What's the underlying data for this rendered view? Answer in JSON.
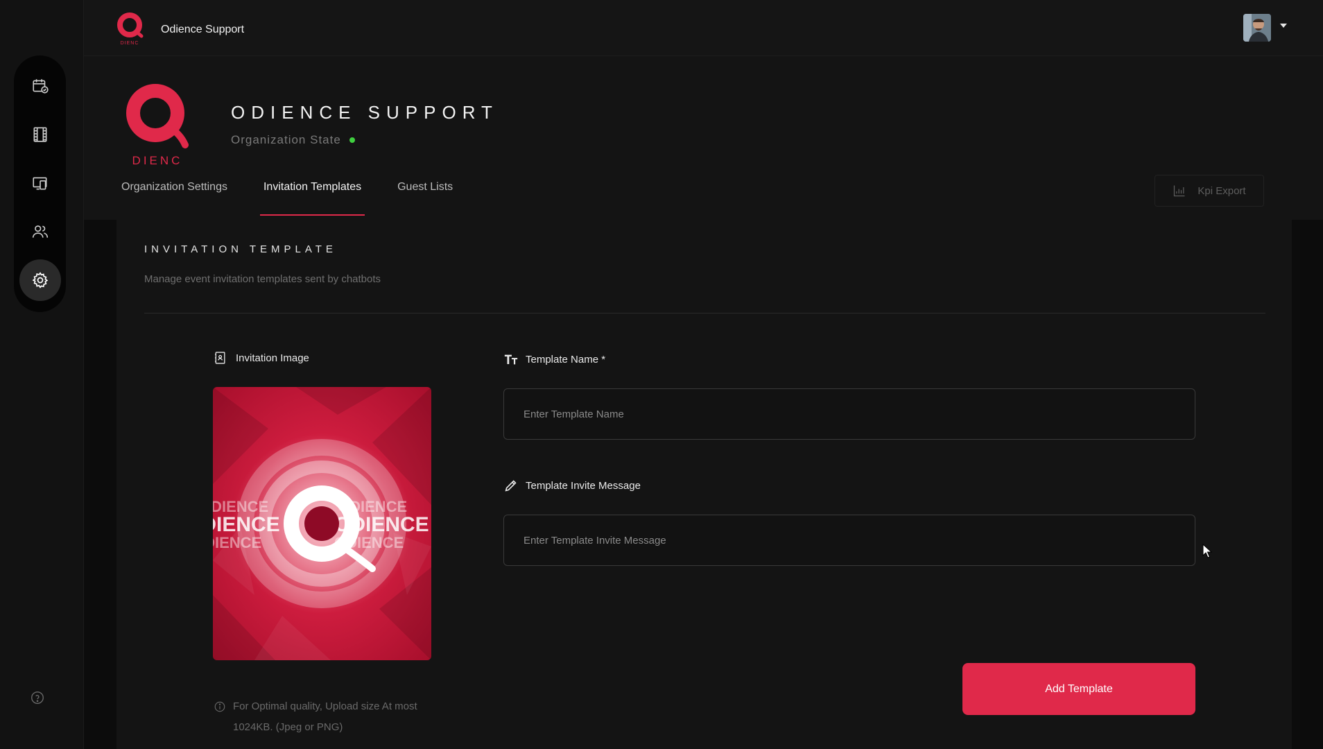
{
  "topbar": {
    "org_name": "Odience Support"
  },
  "sidebar": {
    "items": [
      {
        "name": "calendar",
        "icon": "calendar-check-icon"
      },
      {
        "name": "media",
        "icon": "film-strip-icon"
      },
      {
        "name": "devices",
        "icon": "devices-icon"
      },
      {
        "name": "users",
        "icon": "users-icon"
      },
      {
        "name": "settings",
        "icon": "gear-icon",
        "active": true
      }
    ],
    "help_icon": "help-circle-icon"
  },
  "header": {
    "title": "ODIENCE SUPPORT",
    "state_label": "Organization State",
    "state_color": "#3fcf3f",
    "logo_text": "DIENC",
    "tabs": [
      {
        "label": "Organization Settings",
        "active": false
      },
      {
        "label": "Invitation Templates",
        "active": true
      },
      {
        "label": "Guest Lists",
        "active": false
      }
    ],
    "kpi_label": "Kpi Export"
  },
  "section": {
    "title": "INVITATION TEMPLATE",
    "subtitle": "Manage event invitation templates sent by chatbots"
  },
  "form": {
    "image_label": "Invitation Image",
    "image_text": "ODIENCE",
    "hint": "For Optimal quality, Upload size At most 1024KB. (Jpeg or PNG)",
    "name_label": "Template Name *",
    "name_placeholder": "Enter Template Name",
    "name_value": "",
    "message_label": "Template Invite Message",
    "message_placeholder": "Enter Template Invite Message",
    "message_value": "",
    "submit_label": "Add Template"
  },
  "colors": {
    "accent": "#e0294a",
    "background": "#0c0c0c",
    "panel": "#141414"
  }
}
